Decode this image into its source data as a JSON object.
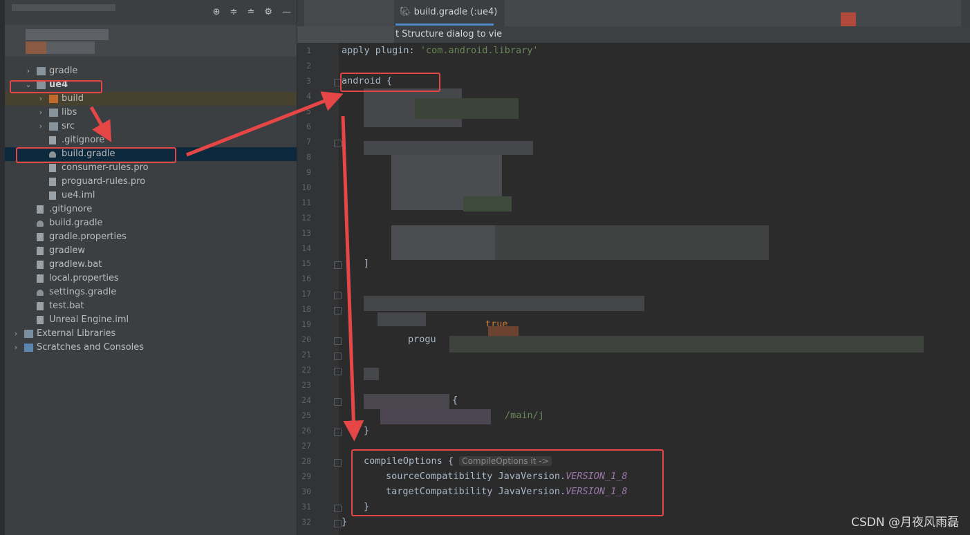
{
  "tab": {
    "label": "build.gradle (:ue4)"
  },
  "banner": {
    "text": "t Structure dialog to vie"
  },
  "tree": {
    "items": [
      {
        "label": "gradle",
        "kind": "folder",
        "depth": 1,
        "arrow": "›"
      },
      {
        "label": "ue4",
        "kind": "module",
        "depth": 1,
        "arrow": "⌄"
      },
      {
        "label": "build",
        "kind": "folder-orange",
        "depth": 2,
        "arrow": "›"
      },
      {
        "label": "libs",
        "kind": "folder",
        "depth": 2,
        "arrow": "›"
      },
      {
        "label": "src",
        "kind": "folder",
        "depth": 2,
        "arrow": "›"
      },
      {
        "label": ".gitignore",
        "kind": "file",
        "depth": 2
      },
      {
        "label": "build.gradle",
        "kind": "gradle",
        "depth": 2
      },
      {
        "label": "consumer-rules.pro",
        "kind": "file",
        "depth": 2
      },
      {
        "label": "proguard-rules.pro",
        "kind": "file",
        "depth": 2
      },
      {
        "label": "ue4.iml",
        "kind": "file",
        "depth": 2
      },
      {
        "label": ".gitignore",
        "kind": "file",
        "depth": 1
      },
      {
        "label": "build.gradle",
        "kind": "gradle",
        "depth": 1
      },
      {
        "label": "gradle.properties",
        "kind": "file",
        "depth": 1
      },
      {
        "label": "gradlew",
        "kind": "file",
        "depth": 1
      },
      {
        "label": "gradlew.bat",
        "kind": "file",
        "depth": 1
      },
      {
        "label": "local.properties",
        "kind": "file",
        "depth": 1
      },
      {
        "label": "settings.gradle",
        "kind": "gradle",
        "depth": 1
      },
      {
        "label": "test.bat",
        "kind": "file",
        "depth": 1
      },
      {
        "label": "Unreal Engine.iml",
        "kind": "file",
        "depth": 1
      },
      {
        "label": "External Libraries",
        "kind": "lib",
        "depth": 0,
        "arrow": "›"
      },
      {
        "label": "Scratches and Consoles",
        "kind": "scratch",
        "depth": 0,
        "arrow": "›"
      }
    ]
  },
  "code": {
    "line1_a": "apply ",
    "line1_b": "plugin: ",
    "line1_c": "'com.android.library'",
    "line3": "android {",
    "line15": "]",
    "line19": "true",
    "line20": "progu",
    "line24": "{",
    "line25": "/main/j",
    "line26": "}",
    "line28": "compileOptions {",
    "line28_hint": "CompileOptions it ->",
    "line29_a": "sourceCompatibility JavaVersion.",
    "line29_b": "VERSION_1_8",
    "line30_a": "targetCompatibility JavaVersion.",
    "line30_b": "VERSION_1_8",
    "line31": "}",
    "line32": "}"
  },
  "line_numbers": [
    "1",
    "2",
    "3",
    "4",
    "5",
    "6",
    "7",
    "8",
    "9",
    "10",
    "11",
    "12",
    "13",
    "14",
    "15",
    "16",
    "17",
    "18",
    "19",
    "20",
    "21",
    "22",
    "23",
    "24",
    "25",
    "26",
    "27",
    "28",
    "29",
    "30",
    "31",
    "32"
  ],
  "watermark": "CSDN @月夜风雨磊",
  "colors": {
    "annotation_red": "#e64646",
    "selection": "#0d293e",
    "accent": "#4a88c7"
  }
}
